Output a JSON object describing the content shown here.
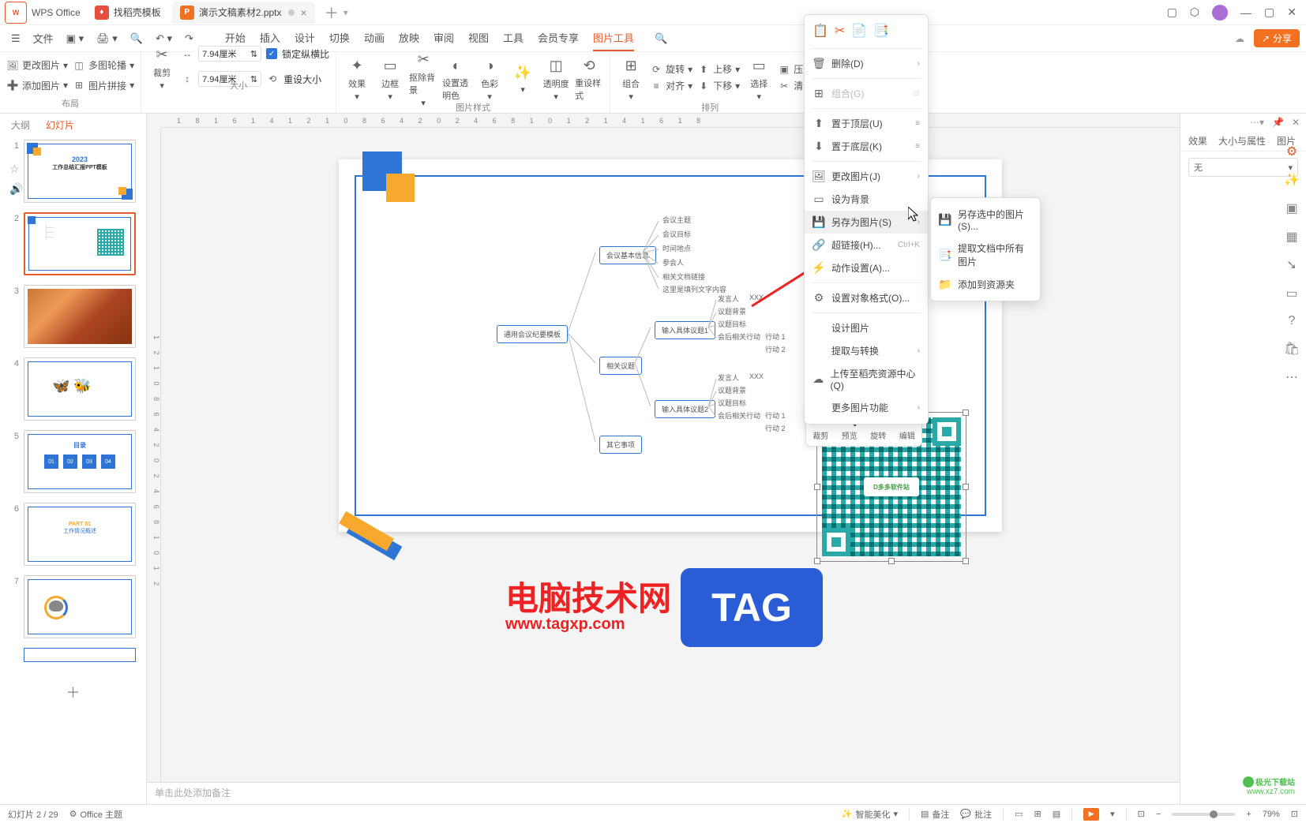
{
  "titlebar": {
    "app_name": "WPS Office",
    "tab1": "找稻壳模板",
    "tab2": "演示文稿素材2.pptx"
  },
  "menubar": {
    "file": "文件",
    "tabs": [
      "开始",
      "插入",
      "设计",
      "切换",
      "动画",
      "放映",
      "审阅",
      "视图",
      "工具",
      "会员专享",
      "图片工具"
    ],
    "share": "分享"
  },
  "ribbon": {
    "layout": {
      "change_pic": "更改图片",
      "multi_rotate": "多图轮播",
      "add_pic": "添加图片",
      "pic_merge": "图片拼接",
      "label": "布局"
    },
    "size": {
      "crop": "裁剪",
      "w": "7.94厘米",
      "h": "7.94厘米",
      "lock": "锁定纵横比",
      "reset": "重设大小",
      "label": "大小"
    },
    "style": {
      "effect": "效果",
      "border": "边框",
      "remove_bg": "抠除背景",
      "set_transparent": "设置透明色",
      "color": "色彩",
      "transparency": "透明度",
      "reset_style": "重设样式",
      "label": "图片样式"
    },
    "arrange": {
      "group": "组合",
      "rotate": "旋转",
      "forward": "上移",
      "align": "对齐",
      "backward": "下移",
      "select": "选择",
      "compress": "压",
      "clean": "清",
      "label": "排列"
    }
  },
  "sidebar": {
    "tab_outline": "大纲",
    "tab_slides": "幻灯片",
    "slides": [
      1,
      2,
      3,
      4,
      5,
      6,
      7
    ]
  },
  "slide_content": {
    "root": "通用会议纪要模板",
    "group1": "会议基本信息",
    "g1_items": [
      "会议主题",
      "会议目标",
      "时间地点",
      "参会人",
      "相关文档链接",
      "这里是填列文字内容"
    ],
    "group2_a": "输入具体议题1",
    "group2_b": "输入具体议题2",
    "group3": "相关议题",
    "group4": "其它事项",
    "sub_items": [
      "发言人",
      "议题背景",
      "议题目标",
      "会后相关行动"
    ],
    "xxx": "XXX",
    "action1": "行动 1",
    "action2": "行动 2",
    "qr_center": "多多软件站"
  },
  "context_menu": {
    "top_icons": [
      "copy",
      "cut",
      "paste",
      "paste-special"
    ],
    "delete": "删除(D)",
    "group": "组合(G)",
    "bring_front": "置于顶层(U)",
    "send_back": "置于底层(K)",
    "change_pic": "更改图片(J)",
    "set_bg": "设为背景",
    "save_as_pic": "另存为图片(S)",
    "hyperlink": "超链接(H)...",
    "hyperlink_sc": "Ctrl+K",
    "action": "动作设置(A)...",
    "format_obj": "设置对象格式(O)...",
    "design_pic": "设计图片",
    "extract_convert": "提取与转换",
    "upload": "上传至稻壳资源中心(Q)",
    "more": "更多图片功能"
  },
  "submenu": {
    "save_selected": "另存选中的图片(S)...",
    "extract_all": "提取文档中所有图片",
    "add_resource": "添加到资源夹"
  },
  "mini_toolbar": {
    "crop": "裁剪",
    "preview": "预览",
    "rotate": "旋转",
    "edit": "编辑"
  },
  "right_panel": {
    "tab_effect": "效果",
    "tab_size": "大小与属性",
    "tab_pic": "图片",
    "select_none": "无"
  },
  "notes": "单击此处添加备注",
  "statusbar": {
    "slide_num": "幻灯片 2 / 29",
    "theme": "Office 主题",
    "beautify": "智能美化",
    "notes": "备注",
    "comments": "批注",
    "zoom": "79%"
  },
  "watermark": {
    "title": "电脑技术网",
    "url": "www.tagxp.com",
    "tag": "TAG",
    "small1": "极光下载站",
    "small2": "www.xz7.com"
  },
  "thumb1": {
    "year": "2023",
    "title": "工作总结汇报PPT模板"
  },
  "thumb5": {
    "title": "目录",
    "n1": "01",
    "n2": "02",
    "n3": "03",
    "n4": "04"
  },
  "thumb6": {
    "part": "PART 01",
    "sub": "工作情况概述"
  }
}
